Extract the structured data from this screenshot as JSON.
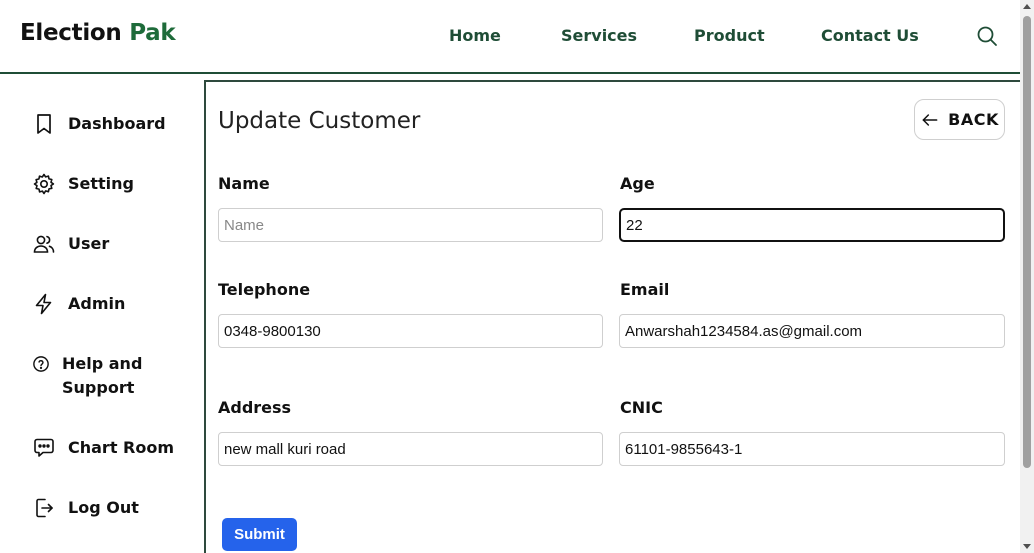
{
  "brand": {
    "name": "Election",
    "accent": "Pak"
  },
  "nav": {
    "home": "Home",
    "services": "Services",
    "product": "Product",
    "contact": "Contact Us"
  },
  "sidebar": {
    "items": [
      {
        "label": "Dashboard",
        "icon": "bookmark-icon"
      },
      {
        "label": "Setting",
        "icon": "gear-icon"
      },
      {
        "label": "User",
        "icon": "users-icon"
      },
      {
        "label": "Admin",
        "icon": "lightning-icon"
      },
      {
        "label": "Help and Support",
        "icon": "help-icon"
      },
      {
        "label": "Chart Room",
        "icon": "chat-icon"
      },
      {
        "label": "Log Out",
        "icon": "logout-icon"
      }
    ]
  },
  "form": {
    "title": "Update Customer",
    "back_label": "BACK",
    "fields": {
      "name": {
        "label": "Name",
        "value": "",
        "placeholder": "Name"
      },
      "age": {
        "label": "Age",
        "value": "22",
        "placeholder": ""
      },
      "telephone": {
        "label": "Telephone",
        "value": "0348-9800130",
        "placeholder": ""
      },
      "email": {
        "label": "Email",
        "value": "Anwarshah1234584.as@gmail.com",
        "placeholder": ""
      },
      "address": {
        "label": "Address",
        "value": "new mall kuri road",
        "placeholder": ""
      },
      "cnic": {
        "label": "CNIC",
        "value": "61101-9855643-1",
        "placeholder": ""
      }
    },
    "submit_label": "Submit"
  },
  "colors": {
    "brand_accent": "#1e6b3a",
    "nav_text": "#1f4d36",
    "submit": "#2563eb"
  }
}
